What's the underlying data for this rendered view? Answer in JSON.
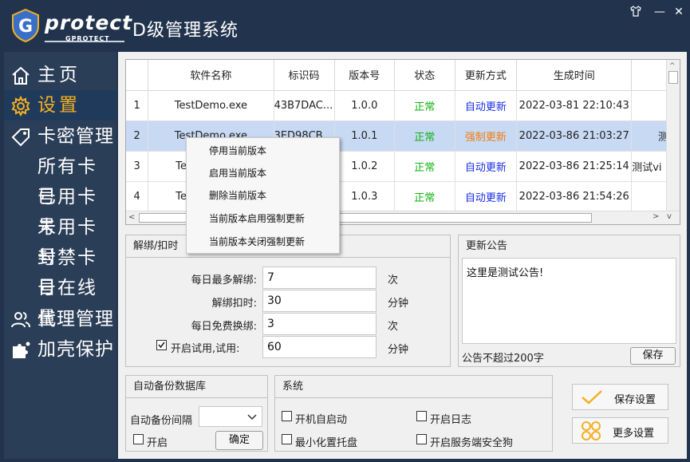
{
  "app": {
    "brand": "protect",
    "brand_sub": "GPROTECT",
    "title": "D级管理系统"
  },
  "colors": {
    "titlebar": "#22344d",
    "sidebar": "#2b3e57",
    "active_nav": "#f4b021",
    "status_ok": "#10b310",
    "mode_auto": "#1a2ee6",
    "mode_forced": "#f27d0c",
    "selected_row": "#c7d9f3"
  },
  "window_controls": {
    "skin_icon": "shirt-icon",
    "minimize": "—",
    "close": "✕"
  },
  "sidebar": {
    "items": [
      {
        "label": "主页",
        "icon": "home-icon"
      },
      {
        "label": "设置",
        "icon": "gear-icon"
      },
      {
        "label": "卡密管理",
        "icon": "tag-icon"
      },
      {
        "label": "所有卡号"
      },
      {
        "label": "已用卡号"
      },
      {
        "label": "未用卡号"
      },
      {
        "label": "封禁卡号"
      },
      {
        "label": "日在线量"
      },
      {
        "label": "代理管理",
        "icon": "users-icon"
      },
      {
        "label": "加壳保护",
        "icon": "puzzle-icon"
      }
    ]
  },
  "table": {
    "headers": [
      "",
      "软件名称",
      "标识码",
      "版本号",
      "状态",
      "更新方式",
      "生成时间",
      ""
    ],
    "rows": [
      {
        "num": "1",
        "name": "TestDemo.exe",
        "code": "43B7DAC...",
        "version": "1.0.0",
        "status": "正常",
        "mode": "自动更新",
        "time": "2022-03-81 22:10:43",
        "extra": ""
      },
      {
        "num": "2",
        "name": "TestDemo.exe",
        "code": "3ED98CB",
        "version": "1.0.1",
        "status": "正常",
        "mode": "强制更新",
        "time": "2022-03-86 21:03:27",
        "extra": "测试"
      },
      {
        "num": "3",
        "name": "Te",
        "code": "",
        "version": "1.0.2",
        "status": "正常",
        "mode": "自动更新",
        "time": "2022-03-86 21:25:14",
        "extra": "测试vi"
      },
      {
        "num": "4",
        "name": "Te",
        "code": "",
        "version": "1.0.3",
        "status": "正常",
        "mode": "自动更新",
        "time": "2022-03-86 21:54:26",
        "extra": ""
      }
    ]
  },
  "context_menu": {
    "items": [
      "停用当前版本",
      "启用当前版本",
      "删除当前版本",
      "当前版本启用强制更新",
      "当前版本关闭强制更新"
    ]
  },
  "unbind": {
    "title": "解绑/扣时",
    "daily_max_label": "每日最多解绑:",
    "daily_max_value": "7",
    "daily_max_unit": "次",
    "deduct_label": "解绑扣时:",
    "deduct_value": "30",
    "deduct_unit": "分钟",
    "free_label": "每日免费换绑:",
    "free_value": "3",
    "free_unit": "次",
    "trial_label": "开启试用,试用:",
    "trial_checked": true,
    "trial_value": "60",
    "trial_unit": "分钟"
  },
  "notice": {
    "title": "更新公告",
    "text": "这里是测试公告!",
    "hint": "公告不超过200字",
    "save_label": "保存"
  },
  "backup": {
    "title": "自动备份数据库",
    "interval_label": "自动备份间隔",
    "interval_value": "",
    "enable_label": "开启",
    "confirm_label": "确定"
  },
  "system": {
    "title": "系统",
    "autostart": "开机自启动",
    "log": "开启日志",
    "tray": "最小化置托盘",
    "guard": "开启服务端安全狗"
  },
  "actions": {
    "save_settings": "保存设置",
    "more_settings": "更多设置"
  }
}
